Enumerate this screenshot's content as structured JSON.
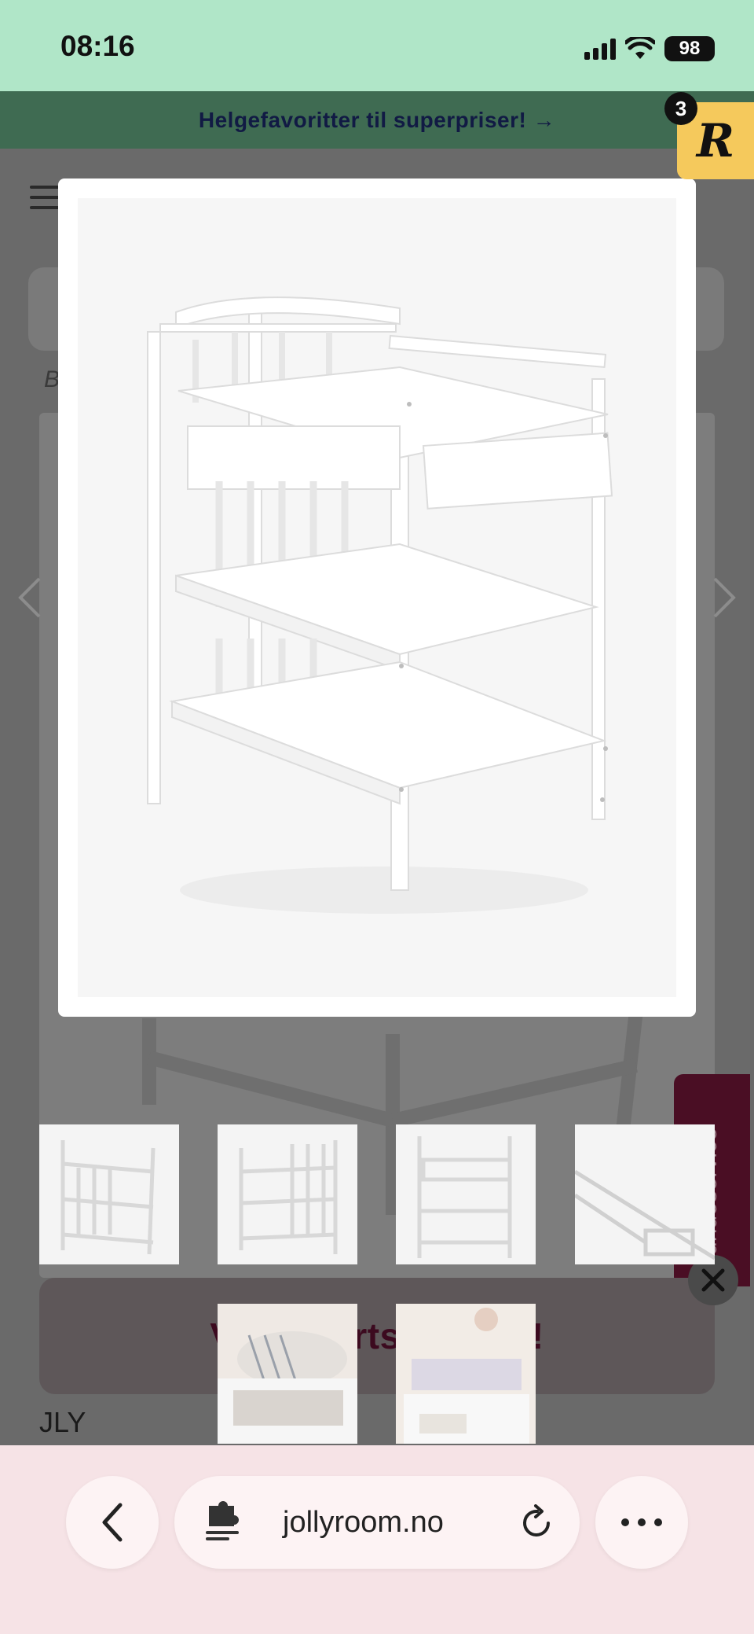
{
  "status_bar": {
    "time": "08:16",
    "battery": "98"
  },
  "promo": {
    "text": "Helgefavoritter til superpriser! →"
  },
  "breadcrumb": {
    "text": "B"
  },
  "side_tab": {
    "label": "Kundeservice"
  },
  "banner": {
    "text": "Vinn ba                rts          Stokke!"
  },
  "product": {
    "brand": "JLY"
  },
  "thumbnails": {
    "count": 6
  },
  "badge": {
    "count": "3",
    "letter": "R"
  },
  "browser": {
    "url": "jollyroom.no"
  },
  "colors": {
    "status_bg": "#b0e6c8",
    "promo_bg": "#3f6b52",
    "browser_bg": "#f6e3e6",
    "badge_bg": "#f5c95c",
    "side_tab_bg": "#4a0e24"
  }
}
